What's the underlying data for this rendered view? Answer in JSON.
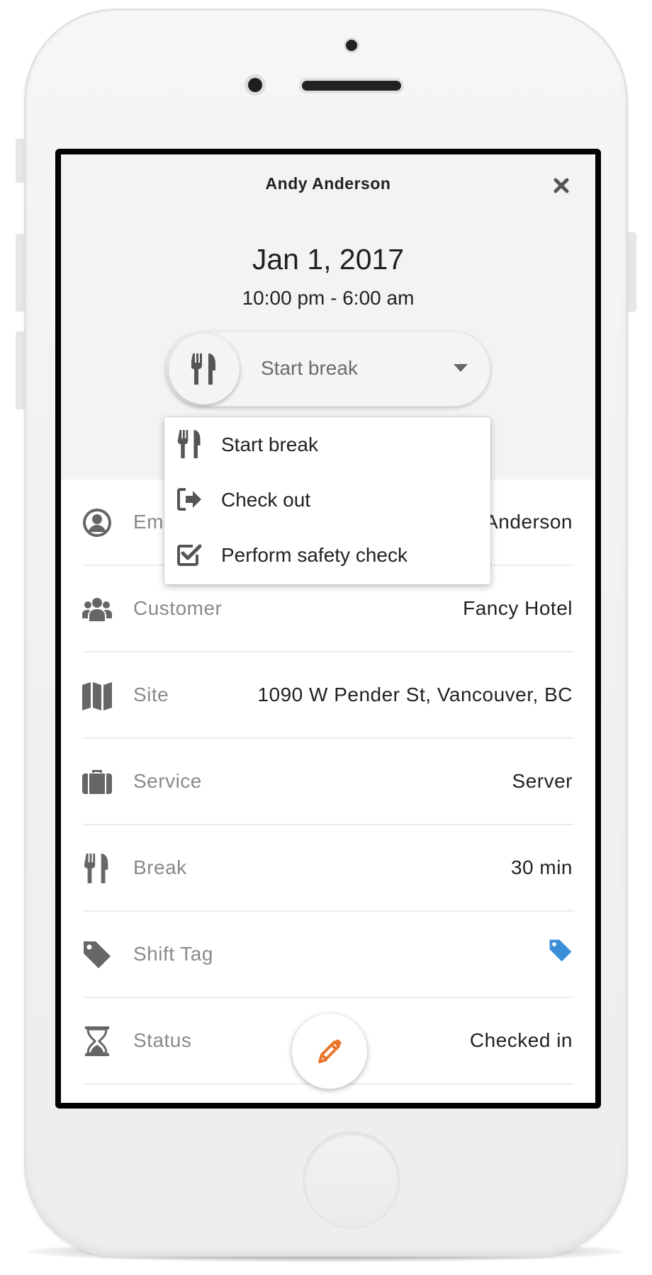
{
  "shift": {
    "employee_name": "Andy Anderson",
    "date": "Jan 1, 2017",
    "time_range": "10:00 pm - 6:00 am"
  },
  "action_button": {
    "label": "Start break",
    "icon": "utensils-icon"
  },
  "action_menu": {
    "items": [
      {
        "label": "Start break",
        "icon": "utensils-icon"
      },
      {
        "label": "Check out",
        "icon": "sign-out-icon"
      },
      {
        "label": "Perform safety check",
        "icon": "checkbox-check-icon"
      }
    ]
  },
  "details": [
    {
      "label": "Emp",
      "value": "Anderson",
      "icon": "user-circle-icon"
    },
    {
      "label": "Customer",
      "value": "Fancy Hotel",
      "icon": "users-icon"
    },
    {
      "label": "Site",
      "value": "1090 W Pender St, Vancouver, BC",
      "icon": "map-icon"
    },
    {
      "label": "Service",
      "value": "Server",
      "icon": "briefcase-icon"
    },
    {
      "label": "Break",
      "value": "30 min",
      "icon": "utensils-icon"
    },
    {
      "label": "Shift Tag",
      "value": "",
      "icon": "tag-icon"
    },
    {
      "label": "Status",
      "value": "Checked in",
      "icon": "hourglass-icon"
    }
  ],
  "colors": {
    "tag_accent": "#3a8fd8",
    "fab_accent": "#e8752a",
    "header_bg": "#f3f3f3"
  },
  "fab": {
    "icon": "pencil-icon"
  }
}
